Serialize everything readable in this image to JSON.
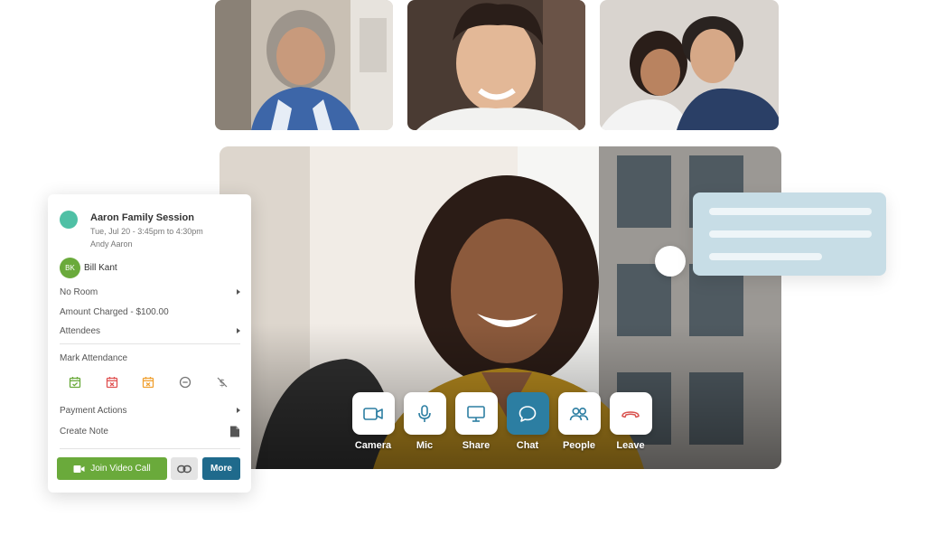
{
  "participants": [
    {
      "name": "participant-1"
    },
    {
      "name": "participant-2"
    },
    {
      "name": "participant-3"
    }
  ],
  "controls": [
    {
      "id": "camera",
      "label": "Camera",
      "icon": "video-camera-icon",
      "active": false
    },
    {
      "id": "mic",
      "label": "Mic",
      "icon": "microphone-icon",
      "active": false
    },
    {
      "id": "share",
      "label": "Share",
      "icon": "screen-share-icon",
      "active": false
    },
    {
      "id": "chat",
      "label": "Chat",
      "icon": "chat-bubble-icon",
      "active": true
    },
    {
      "id": "people",
      "label": "People",
      "icon": "people-icon",
      "active": false
    },
    {
      "id": "leave",
      "label": "Leave",
      "icon": "hang-up-icon",
      "active": false
    }
  ],
  "appointment": {
    "title": "Aaron Family Session",
    "time": "Tue, Jul 20 - 3:45pm to 4:30pm",
    "host": "Andy Aaron",
    "client_initials": "BK",
    "client_name": "Bill Kant",
    "room": "No Room",
    "amount": "Amount Charged - $100.00",
    "attendees": "Attendees",
    "mark_attendance": "Mark Attendance",
    "attendance_icons": [
      "calendar-check-icon",
      "calendar-x-icon",
      "calendar-cancel-icon",
      "minus-circle-icon",
      "no-dollar-icon"
    ],
    "payment_actions": "Payment Actions",
    "create_note": "Create Note",
    "join_label": "Join Video Call",
    "more_label": "More"
  },
  "colors": {
    "brand_green": "#6aaa3b",
    "brand_blue": "#1f6a8c",
    "chat_active": "#2c7ea2",
    "session_dot": "#4fc0a5",
    "leave_red": "#d9534f",
    "chat_card": "#c7dde6"
  }
}
